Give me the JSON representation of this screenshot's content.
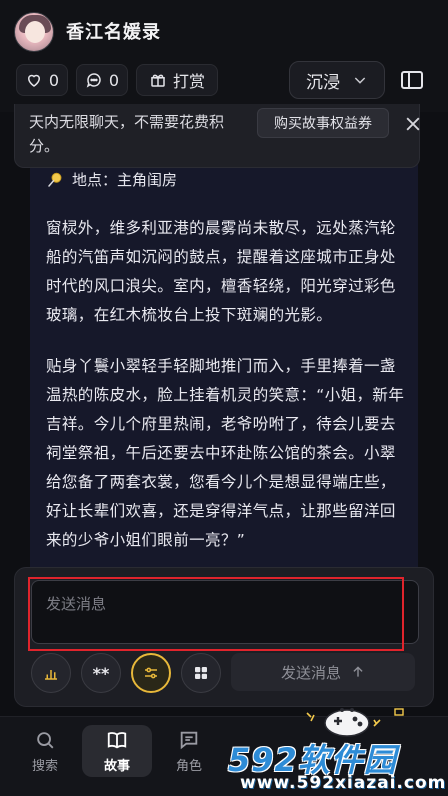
{
  "header": {
    "title": "香江名媛录",
    "like_count": "0",
    "comment_count": "0",
    "tip_label": "打赏",
    "mode_label": "沉浸"
  },
  "notice": {
    "text": "天内无限聊天，不需要花费积分。",
    "button_label": "购买故事权益券"
  },
  "story": {
    "location": "地点：主角闺房",
    "paragraphs": [
      "窗棂外，维多利亚港的晨雾尚未散尽，远处蒸汽轮船的汽笛声如沉闷的鼓点，提醒着这座城市正身处时代的风口浪尖。室内，檀香轻绕，阳光穿过彩色玻璃，在红木梳妆台上投下斑斓的光影。",
      "贴身丫鬟小翠轻手轻脚地推门而入，手里捧着一盏温热的陈皮水，脸上挂着机灵的笑意：“小姐，新年吉祥。今儿个府里热闹，老爷吩咐了，待会儿要去祠堂祭祖，午后还要去中环赴陈公馆的茶会。小翠给您备了两套衣裳，您看今儿个是想显得端庄些，好让长辈们欢喜，还是穿得洋气点，让那些留洋回来的少爷小姐们眼前一亮？”"
    ]
  },
  "composer": {
    "placeholder": "发送消息",
    "value": "",
    "tool_star_label": "**",
    "send_label": "发送消息"
  },
  "nav": {
    "items": [
      {
        "label": "搜索"
      },
      {
        "label": "故事"
      },
      {
        "label": "角色"
      }
    ]
  },
  "watermark": {
    "site_name": "592软件园",
    "url": "www.592xiazai.com"
  },
  "colors": {
    "accent": "#e8b83a",
    "highlight_box": "#e0242c",
    "background": "#0e0f13",
    "story_panel": "#16182a"
  }
}
